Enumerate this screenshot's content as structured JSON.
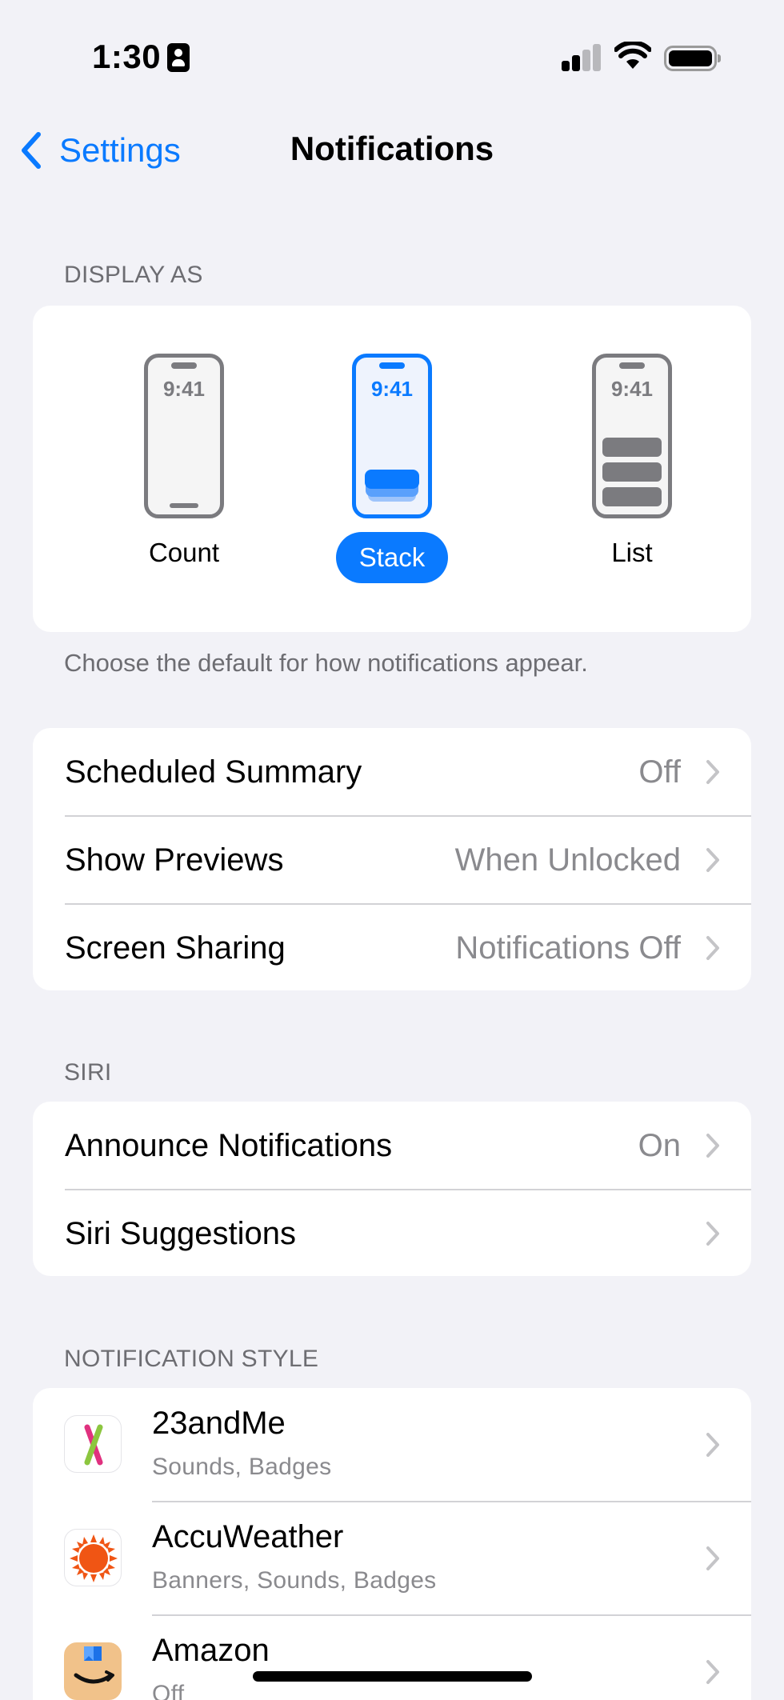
{
  "status_bar": {
    "time": "1:30"
  },
  "nav": {
    "back_label": "Settings",
    "title": "Notifications"
  },
  "display_as": {
    "header": "DISPLAY AS",
    "options": [
      {
        "label": "Count",
        "phone_time": "9:41",
        "selected": false
      },
      {
        "label": "Stack",
        "phone_time": "9:41",
        "selected": true
      },
      {
        "label": "List",
        "phone_time": "9:41",
        "selected": false
      }
    ],
    "footer": "Choose the default for how notifications appear."
  },
  "general_rows": [
    {
      "label": "Scheduled Summary",
      "value": "Off"
    },
    {
      "label": "Show Previews",
      "value": "When Unlocked"
    },
    {
      "label": "Screen Sharing",
      "value": "Notifications Off"
    }
  ],
  "siri": {
    "header": "SIRI",
    "rows": [
      {
        "label": "Announce Notifications",
        "value": "On"
      },
      {
        "label": "Siri Suggestions",
        "value": ""
      }
    ]
  },
  "notification_style": {
    "header": "NOTIFICATION STYLE",
    "apps": [
      {
        "name": "23andMe",
        "subtitle": "Sounds, Badges",
        "icon": "23andme-icon"
      },
      {
        "name": "AccuWeather",
        "subtitle": "Banners, Sounds, Badges",
        "icon": "accuweather-icon"
      },
      {
        "name": "Amazon",
        "subtitle": "Off",
        "icon": "amazon-icon"
      }
    ]
  },
  "colors": {
    "accent": "#0a7aff",
    "background": "#f2f2f7",
    "secondary_text": "#8a8a8e",
    "accuweather_orange": "#f05514",
    "amazon_tan": "#f1c28a"
  }
}
